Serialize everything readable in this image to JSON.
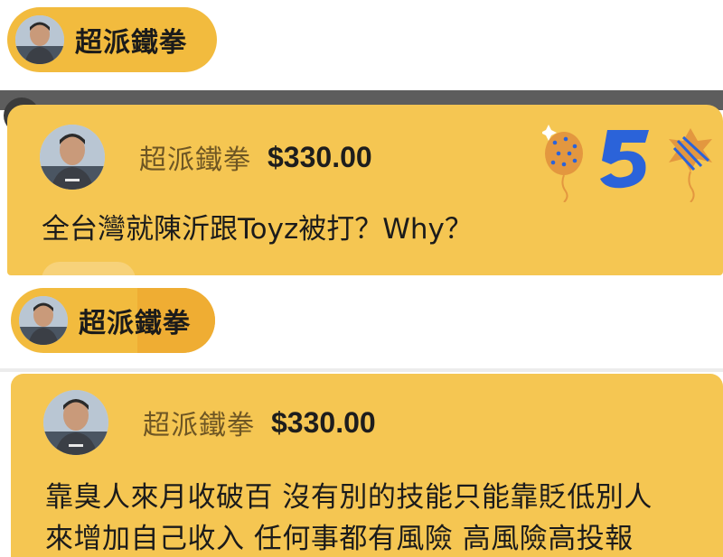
{
  "chat": {
    "pill_top": {
      "avatar_icon": "user-avatar-icon",
      "name": "超派鐵拳"
    },
    "superchat_1": {
      "avatar_icon": "user-avatar-icon",
      "name": "超派鐵拳",
      "amount": "$330.00",
      "message": "全台灣就陳沂跟Toyz被打？Why？",
      "decoration_icon": "anniversary-5-balloons-icon",
      "colors": {
        "card": "#f5c652",
        "name": "#6e5624"
      }
    },
    "pill_bottom": {
      "avatar_icon": "user-avatar-icon",
      "name": "超派鐵拳"
    },
    "superchat_2": {
      "avatar_icon": "user-avatar-icon",
      "name": "超派鐵拳",
      "amount": "$330.00",
      "message": "靠臭人來月收破百 沒有別的技能只能靠貶低別人\n來增加自己收入 任何事都有風險 高風險高投報"
    }
  },
  "colors": {
    "pill": "#f2bb3e",
    "card": "#f5c652",
    "accent_blue": "#2b63d9"
  }
}
